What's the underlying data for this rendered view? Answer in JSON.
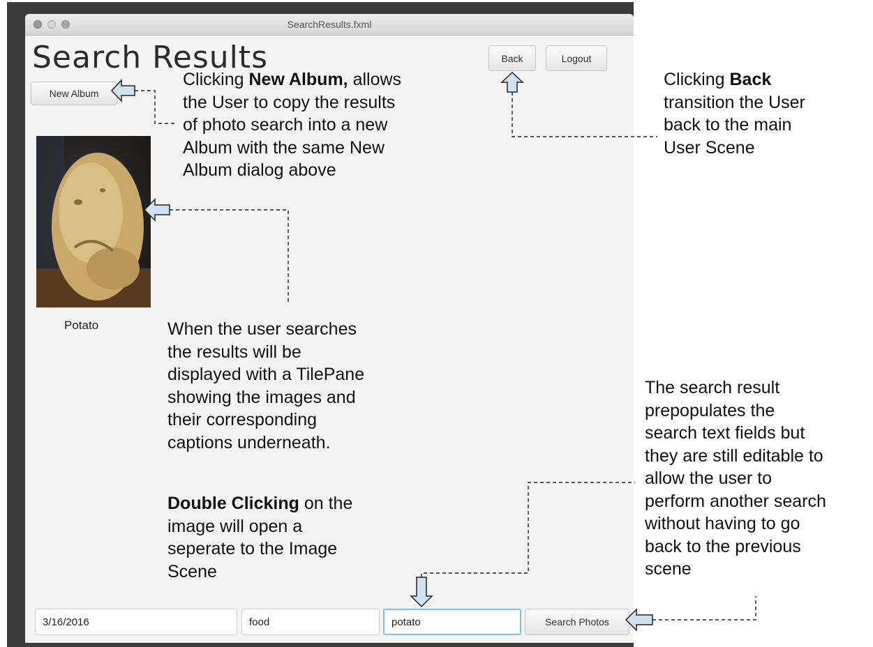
{
  "window": {
    "title": "SearchResults.fxml"
  },
  "page": {
    "title": "Search Results"
  },
  "toolbar": {
    "back_label": "Back",
    "logout_label": "Logout",
    "new_album_label": "New Album"
  },
  "results": [
    {
      "caption": "Potato"
    }
  ],
  "search": {
    "date_value": "3/16/2016",
    "tag_type_value": "food",
    "tag_value": "potato",
    "search_button_label": "Search Photos"
  },
  "annotations": {
    "new_album": {
      "pre": "Clicking ",
      "bold": "New Album,",
      "post": " allows\nthe User to copy the results\nof photo search into a new\nAlbum with the same New\nAlbum dialog above"
    },
    "back": {
      "pre": "Clicking ",
      "bold": "Back",
      "post": "\ntransition the User\nback to the main\nUser Scene"
    },
    "tilepane": {
      "text": "When the user searches\nthe results will be\ndisplayed with a TilePane\nshowing the images and\ntheir corresponding\ncaptions underneath."
    },
    "double_click": {
      "bold": "Double Clicking",
      "post": " on the\nimage will open a\nseperate to the Image\nScene"
    },
    "prepopulate": {
      "text": "The search result\nprepopulates the\nsearch text fields but\nthey are still editable to\nallow the user to\nperform another search\nwithout having to go\nback to the previous\nscene"
    }
  },
  "colors": {
    "arrow_fill": "#cfe0f1",
    "focus_ring": "#7ec1e6"
  }
}
